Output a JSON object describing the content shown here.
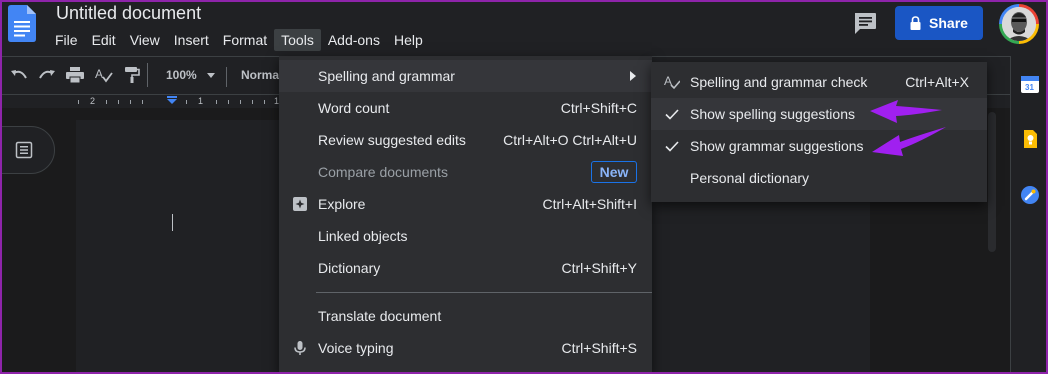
{
  "header": {
    "doc_title": "Untitled document",
    "menus": [
      "File",
      "Edit",
      "View",
      "Insert",
      "Format",
      "Tools",
      "Add-ons",
      "Help"
    ],
    "active_menu": "Tools",
    "share_label": "Share"
  },
  "toolbar": {
    "zoom": "100%",
    "style": "Normal"
  },
  "ruler": {
    "numbers": [
      "2",
      "1",
      "1"
    ]
  },
  "tools_menu": {
    "items": [
      {
        "label": "Spelling and grammar",
        "shortcut": "",
        "submenu": true,
        "icon": ""
      },
      {
        "label": "Word count",
        "shortcut": "Ctrl+Shift+C",
        "icon": ""
      },
      {
        "label": "Review suggested edits",
        "shortcut": "Ctrl+Alt+O Ctrl+Alt+U",
        "icon": ""
      },
      {
        "label": "Compare documents",
        "shortcut": "",
        "badge": "New",
        "disabled": true,
        "icon": ""
      },
      {
        "label": "Explore",
        "shortcut": "Ctrl+Alt+Shift+I",
        "icon": "explore-icon"
      },
      {
        "label": "Linked objects",
        "shortcut": "",
        "icon": ""
      },
      {
        "label": "Dictionary",
        "shortcut": "Ctrl+Shift+Y",
        "icon": ""
      },
      {
        "label": "Translate document",
        "shortcut": "",
        "icon": ""
      },
      {
        "label": "Voice typing",
        "shortcut": "Ctrl+Shift+S",
        "icon": "microphone-icon"
      }
    ]
  },
  "spelling_submenu": {
    "items": [
      {
        "label": "Spelling and grammar check",
        "shortcut": "Ctrl+Alt+X",
        "icon": "spellcheck-icon"
      },
      {
        "label": "Show spelling suggestions",
        "checked": true
      },
      {
        "label": "Show grammar suggestions",
        "checked": true
      },
      {
        "label": "Personal dictionary",
        "checked": false
      }
    ]
  },
  "colors": {
    "background": "#202124",
    "menu_bg": "#2d2e31",
    "share_blue": "#1a56c4",
    "annotation_purple": "#a020f0",
    "frame_purple": "#8e24aa"
  }
}
